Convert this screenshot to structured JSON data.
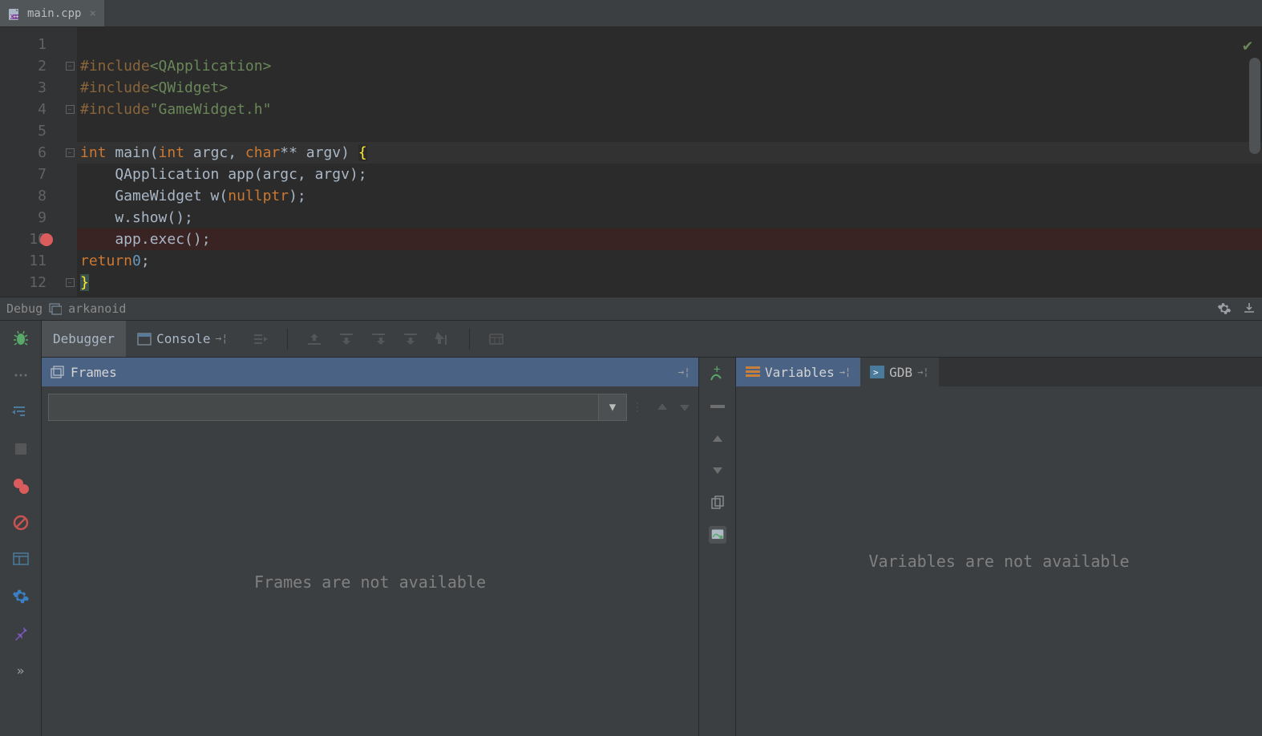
{
  "editor": {
    "tab": {
      "filename": "main.cpp"
    },
    "lines": [
      {
        "n": 1,
        "html": ""
      },
      {
        "n": 2,
        "fold": true,
        "html": "<span class='incl'>#include</span> <span class='str'>&lt;QApplication&gt;</span>"
      },
      {
        "n": 3,
        "html": "<span class='incl'>#include</span> <span class='str'>&lt;QWidget&gt;</span>"
      },
      {
        "n": 4,
        "fold": true,
        "html": "<span class='incl'>#include</span> <span class='str'>\"GameWidget.h\"</span>"
      },
      {
        "n": 5,
        "html": ""
      },
      {
        "n": 6,
        "fold": true,
        "highlight": true,
        "html": "<span class='kw'>int</span> main(<span class='kw'>int</span> argc, <span class='kw'>char</span>** argv) <span class='cursor-caret'>{</span>"
      },
      {
        "n": 7,
        "html": "    QApplication app(argc, argv);"
      },
      {
        "n": 8,
        "html": "    GameWidget w(<span class='kw'>nullptr</span>);"
      },
      {
        "n": 9,
        "html": "    w.show();"
      },
      {
        "n": 10,
        "bp": true,
        "html": "    app.exec();"
      },
      {
        "n": 11,
        "html": "    <span class='kw'>return</span> <span class='num'>0</span>;"
      },
      {
        "n": 12,
        "fold": true,
        "html": "<span class='bracket-hl'>}</span>"
      }
    ]
  },
  "debug": {
    "header_label": "Debug",
    "project_name": "arkanoid",
    "tabs": {
      "debugger": "Debugger",
      "console": "Console"
    },
    "frames": {
      "title": "Frames",
      "placeholder": "Frames are not available"
    },
    "variables": {
      "title": "Variables",
      "gdb_title": "GDB",
      "placeholder": "Variables are not available"
    }
  }
}
